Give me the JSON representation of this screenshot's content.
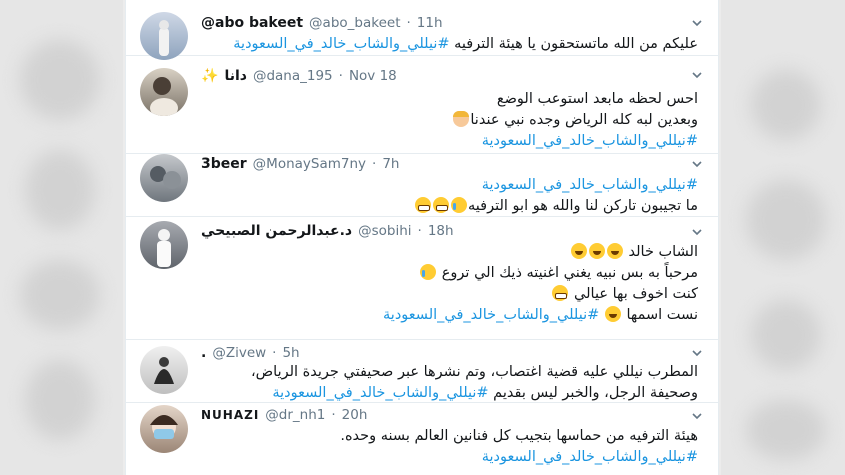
{
  "colors": {
    "link": "#1b95e0",
    "text": "#14171a",
    "muted": "#657786",
    "background": "#ffffff"
  },
  "tweets": [
    {
      "name": "@abo bakeet",
      "handle": "@abo_bakeet",
      "time": "11h",
      "lines": [
        {
          "text": "عليكم من الله ماتستحقون يا هيئة الترفيه ",
          "tag": "#نيللي_والشاب_خالد_في_السعودية"
        }
      ]
    },
    {
      "name": "دانا",
      "name_icon": "sparkles-icon",
      "handle": "@dana_195",
      "time": "Nov 18",
      "lines": [
        {
          "text": "احس لحظه مابعد استوعب الوضع"
        },
        {
          "text": "وبعدين لبه كله الرياض وجده نبي عندنا",
          "emoji": "woman-emoji"
        },
        {
          "tag": "#نيللي_والشاب_خالد_في_السعودية"
        }
      ]
    },
    {
      "name": "3beer",
      "handle": "@MonaySam7ny",
      "time": "7h",
      "lines": [
        {
          "tag": "#نيللي_والشاب_خالد_في_السعودية"
        },
        {
          "text": "ما تجيبون تاركن لنا  والله هو ابو الترفيه",
          "emoji": "cry-grin-emoji"
        }
      ]
    },
    {
      "name": "د.عبدالرحمن الصبيحي",
      "handle": "@sobihi",
      "time": "18h",
      "lines": [
        {
          "text": "الشاب خالد",
          "emoji": "laugh-emoji"
        },
        {
          "text": "مرحباً به بس نبيه يغني اغنيته ذيك الي تروع",
          "emoji": "tired-emoji"
        },
        {
          "text": "كنت اخوف بها عيالي",
          "emoji": "grin-emoji"
        },
        {
          "text": "نست اسمها ",
          "tag": "#نيللي_والشاب_خالد_في_السعودية",
          "emoji": "laugh-emoji"
        }
      ]
    },
    {
      "name": ".",
      "handle": "@Zivew",
      "time": "5h",
      "lines": [
        {
          "text": "المطرب نيللي عليه قضية اغتصاب، وتم نشرها عبر صحيفتي جريدة الرياض،"
        },
        {
          "text": "وصحيفة الرجل، والخبر ليس بقديم ",
          "tag": "#نيللي_والشاب_خالد_في_السعودية"
        }
      ]
    },
    {
      "name": "NUHAZI",
      "handle": "@dr_nh1",
      "time": "20h",
      "lines": [
        {
          "text": "هيئة الترفيه من حماسها بتجيب كل فنانين العالم بسنه وحده."
        },
        {
          "tag": "#نيللي_والشاب_خالد_في_السعودية"
        }
      ]
    }
  ]
}
